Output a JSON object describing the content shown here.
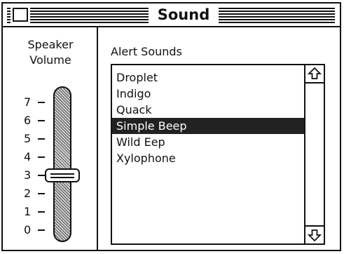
{
  "window": {
    "title": "Sound"
  },
  "speaker_volume": {
    "label_line1": "Speaker",
    "label_line2": "Volume",
    "ticks": [
      "7",
      "6",
      "5",
      "4",
      "3",
      "2",
      "1",
      "0"
    ],
    "value": 3
  },
  "alert_sounds": {
    "label": "Alert Sounds",
    "items": [
      "Droplet",
      "Indigo",
      "Quack",
      "Simple Beep",
      "Wild Eep",
      "Xylophone"
    ],
    "selected": "Simple Beep"
  },
  "icons": {
    "close_box": "close-box-icon",
    "scroll_up": "up-arrow-icon",
    "scroll_down": "down-arrow-icon"
  },
  "colors": {
    "selection": "#222222",
    "ink": "#111111",
    "background": "#ffffff"
  }
}
